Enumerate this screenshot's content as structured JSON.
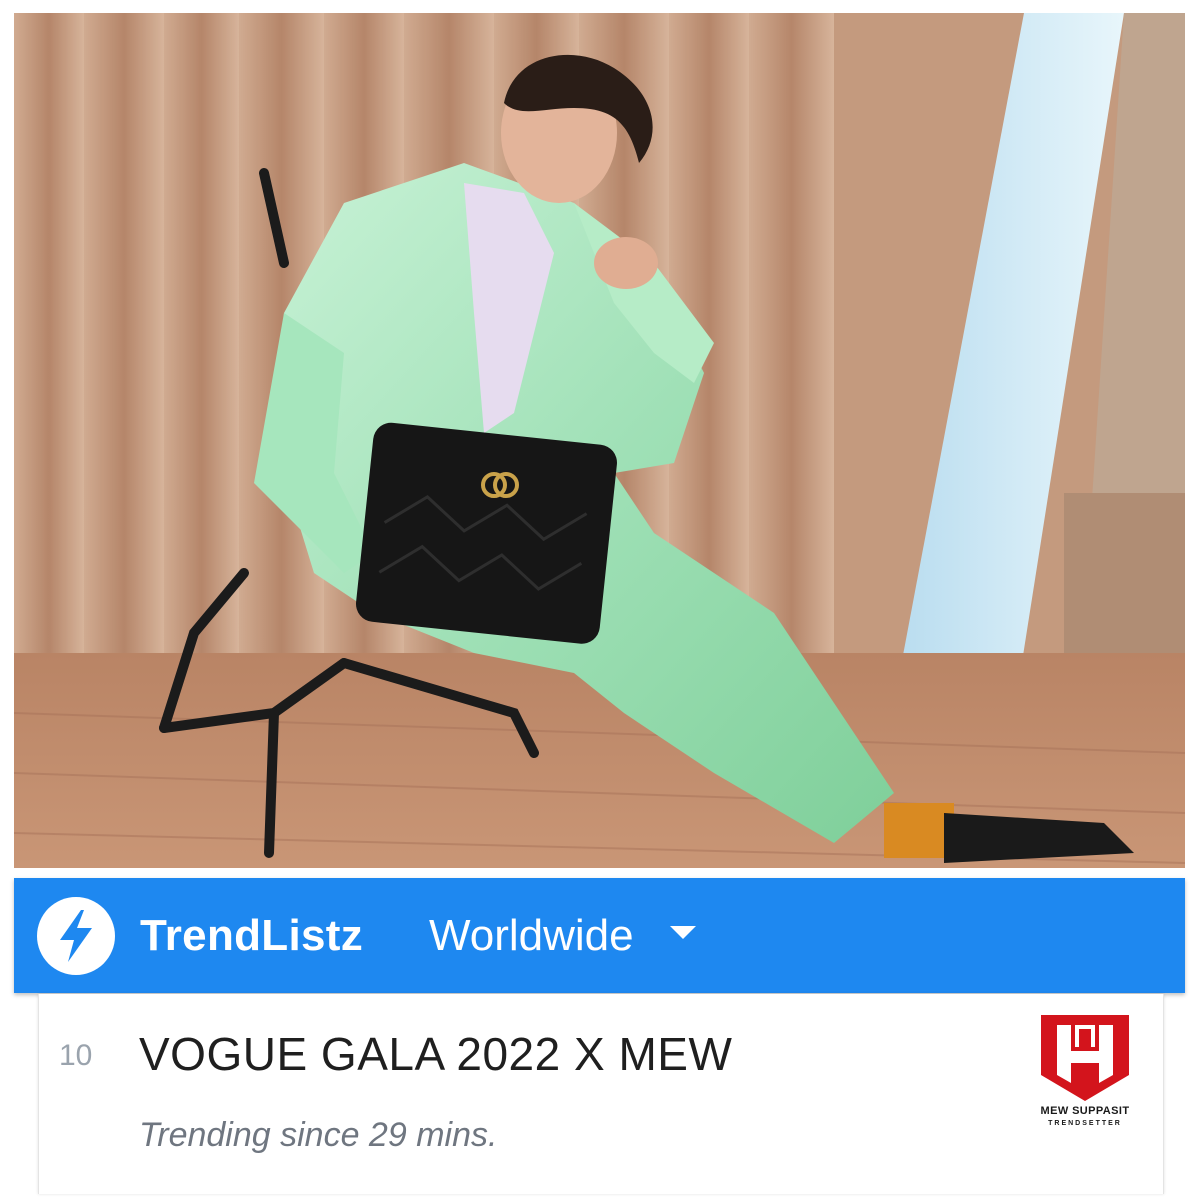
{
  "photo": {
    "subject": "man-in-mint-green-suit-with-black-clutch"
  },
  "appbar": {
    "app_name": "TrendListz",
    "logo_icon": "lightning-bolt-icon",
    "region_label": "Worldwide",
    "region_icon": "chevron-down-icon",
    "color": "#1e88f0"
  },
  "trend": {
    "rank": "10",
    "title": "VOGUE GALA 2022 X MEW",
    "since": "Trending since 29 mins."
  },
  "brand": {
    "name": "MEW SUPPASIT",
    "tagline": "TRENDSETTER",
    "color": "#d3141c"
  }
}
